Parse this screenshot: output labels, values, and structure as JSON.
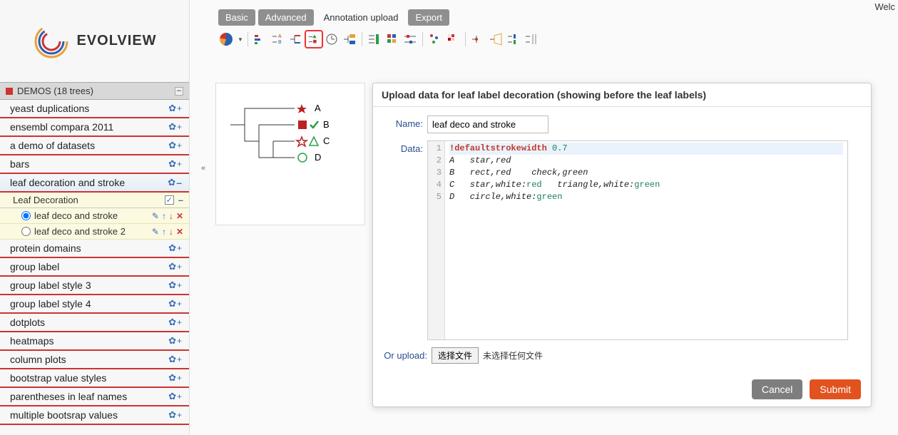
{
  "topbar": {
    "welcome": "Welc"
  },
  "logo": {
    "text": "EVOLVIEW"
  },
  "sidebar": {
    "header": "DEMOS (18 trees)",
    "items": [
      {
        "label": "yeast duplications"
      },
      {
        "label": "ensembl compara 2011"
      },
      {
        "label": "a demo of datasets"
      },
      {
        "label": "bars"
      },
      {
        "label": "leaf decoration and stroke",
        "active": true
      },
      {
        "label": "protein domains"
      },
      {
        "label": "group label"
      },
      {
        "label": "group label style 3"
      },
      {
        "label": "group label style 4"
      },
      {
        "label": "dotplots"
      },
      {
        "label": "heatmaps"
      },
      {
        "label": "column plots"
      },
      {
        "label": "bootstrap value styles"
      },
      {
        "label": "parentheses in leaf names"
      },
      {
        "label": "multiple bootsrap values"
      }
    ],
    "sub_header": "Leaf Decoration",
    "datasets": [
      {
        "label": "leaf deco and stroke",
        "checked": true
      },
      {
        "label": "leaf deco and stroke 2",
        "checked": false
      }
    ]
  },
  "tabs": {
    "basic": "Basic",
    "advanced": "Advanced",
    "annotation": "Annotation upload",
    "export": "Export"
  },
  "tree": {
    "leaves": [
      "A",
      "B",
      "C",
      "D"
    ]
  },
  "dialog": {
    "title": "Upload data for leaf label decoration (showing before the leaf labels)",
    "name_label": "Name:",
    "name_value": "leaf deco and stroke",
    "data_label": "Data:",
    "code": {
      "l1_kw": "!defaultstrokewidth",
      "l1_num": "0.7",
      "l2": "A   star,red",
      "l3": "B   rect,red    check,green",
      "l4_a": "C   star,white:",
      "l4_b": "red",
      "l4_c": "   triangle,white:",
      "l4_d": "green",
      "l5_a": "D   circle,white:",
      "l5_b": "green"
    },
    "upload_label": "Or upload:",
    "file_button": "选择文件",
    "file_status": "未选择任何文件",
    "cancel": "Cancel",
    "submit": "Submit"
  }
}
